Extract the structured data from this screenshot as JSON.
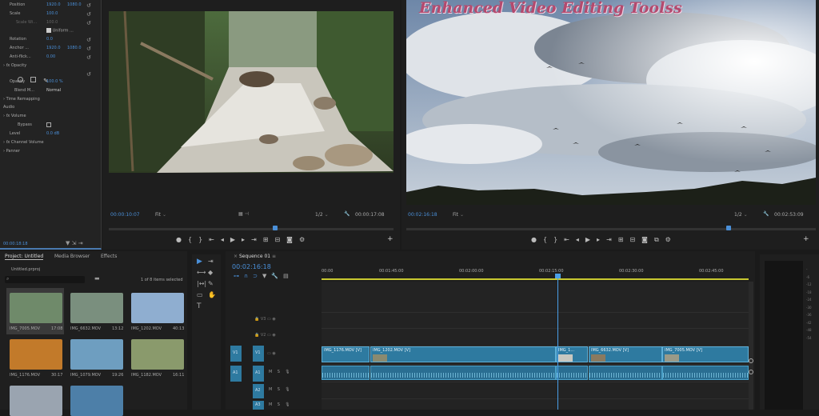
{
  "effect_controls": {
    "rows": [
      {
        "label": "Position",
        "v1": "1920.0",
        "v2": "1080.0"
      },
      {
        "label": "Scale",
        "v1": "100.0",
        "v2": ""
      },
      {
        "label": "Scale Wi...",
        "v1": "100.0",
        "v2": ""
      },
      {
        "label": "",
        "v1": "Uniform ...",
        "v2": ""
      },
      {
        "label": "Rotation",
        "v1": "0.0",
        "v2": ""
      },
      {
        "label": "Anchor ...",
        "v1": "1920.0",
        "v2": "1080.0"
      },
      {
        "label": "Anti-flick...",
        "v1": "0.00",
        "v2": ""
      }
    ],
    "opacity_section": "Opacity",
    "opacity_label": "Opacity",
    "opacity_value": "100.0 %",
    "blend_label": "Blend M...",
    "blend_value": "Normal",
    "time_remapping": "Time Remapping",
    "audio_header": "Audio",
    "volume_section": "Volume",
    "bypass_label": "Bypass",
    "level_label": "Level",
    "level_value": "0.0 dB",
    "channel_volume": "Channel Volume",
    "panner": "Panner",
    "timecode": "00:00:18:18"
  },
  "source_monitor": {
    "timecode_left": "00:00:10:07",
    "fit": "Fit",
    "fraction": "1/2",
    "timecode_right": "00:00:17:08"
  },
  "program_monitor": {
    "watermark": "Enhanced Video Editing Toolss",
    "timecode_left": "00:02:16:18",
    "fit": "Fit",
    "fraction": "1/2",
    "timecode_right": "00:02:53:09"
  },
  "project": {
    "tabs": [
      "Project: Untitled",
      "Media Browser",
      "Effects"
    ],
    "file": "Untitled.prproj",
    "items_selected": "1 of 8 items selected",
    "clips": [
      {
        "name": "IMG_7005.MOV",
        "dur": "17:08",
        "color": "#6f8a6a"
      },
      {
        "name": "IMG_6632.MOV",
        "dur": "13:12",
        "color": "#7a8f7e"
      },
      {
        "name": "IMG_1202.MOV",
        "dur": "40:13",
        "color": "#8faed0"
      },
      {
        "name": "IMG_1176.MOV",
        "dur": "30:17",
        "color": "#c27a2a"
      },
      {
        "name": "IMG_1079.MOV",
        "dur": "19:26",
        "color": "#6e9ec0"
      },
      {
        "name": "IMG_1182.MOV",
        "dur": "16:11",
        "color": "#8a9a6c"
      },
      {
        "name": "",
        "dur": "",
        "color": "#9aa4b0"
      },
      {
        "name": "",
        "dur": "",
        "color": "#4d7fa8"
      }
    ]
  },
  "timeline": {
    "tab": "Sequence 01",
    "timecode": "00:02:16:18",
    "ruler": [
      "00:00",
      "00:01:45:00",
      "00:02:00:00",
      "00:02:15:00",
      "00:02:30:00",
      "00:02:45:00"
    ],
    "video_tracks": [
      "V3",
      "V2",
      "V1"
    ],
    "audio_tracks": [
      "A1",
      "A2",
      "A3"
    ],
    "source_patch": [
      "V1",
      "A1"
    ],
    "clips": [
      {
        "label": "IMG_1176.MOV [V]"
      },
      {
        "label": "IMG_1202.MOV [V]"
      },
      {
        "label": "IMG_1..."
      },
      {
        "label": "IMG_6632.MOV [V]"
      },
      {
        "label": "IMG_7005.MOV [V]"
      }
    ],
    "audio_m": "M",
    "audio_s": "S"
  },
  "colors": {
    "accent": "#4a8fd8",
    "clip": "#2e7aa0",
    "playhead": "#4a9fe8",
    "work_area": "#c8c830"
  }
}
